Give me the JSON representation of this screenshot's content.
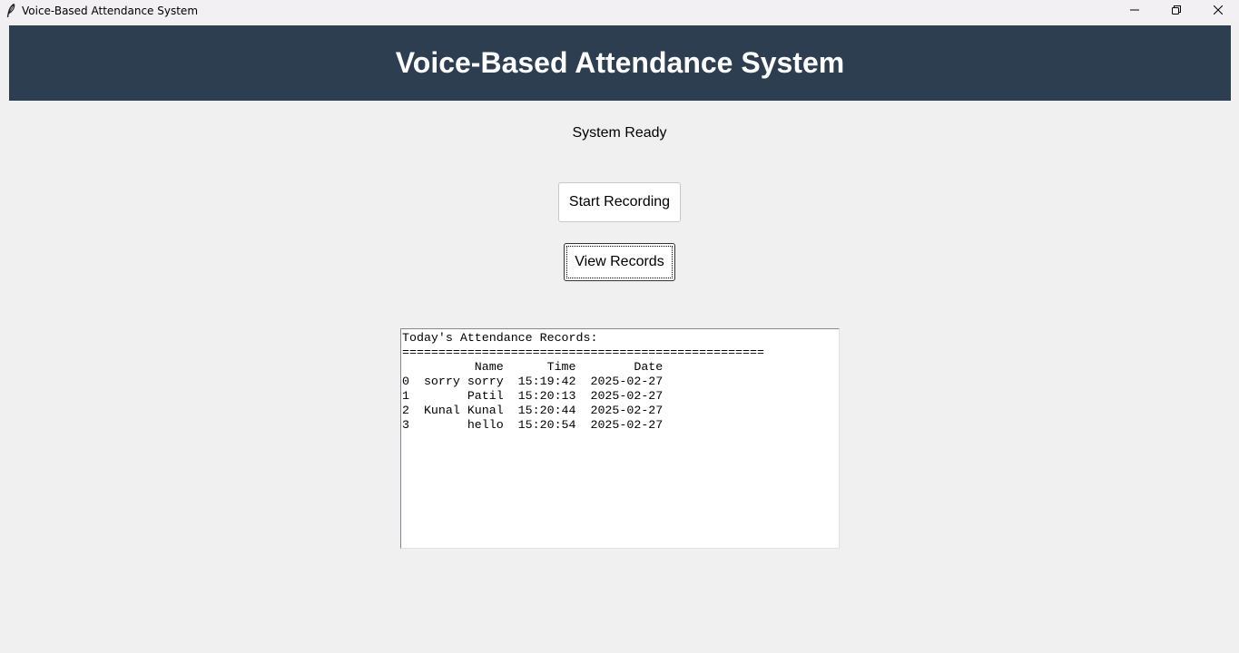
{
  "window": {
    "title": "Voice-Based Attendance System",
    "controls": {
      "minimize_icon": "minimize-icon",
      "maximize_icon": "restore-icon",
      "close_icon": "close-icon"
    }
  },
  "header": {
    "title": "Voice-Based Attendance System",
    "background": "#2c3e50"
  },
  "status": {
    "text": "System Ready"
  },
  "buttons": {
    "start_label": "Start Recording",
    "view_label": "View Records"
  },
  "records": {
    "heading": "Today's Attendance Records:",
    "separator": "==================================================",
    "header_line": "          Name      Time        Date",
    "rows": [
      "0  sorry sorry  15:19:42  2025-02-27",
      "1        Patil  15:20:13  2025-02-27",
      "2  Kunal Kunal  15:20:44  2025-02-27",
      "3        hello  15:20:54  2025-02-27"
    ]
  }
}
